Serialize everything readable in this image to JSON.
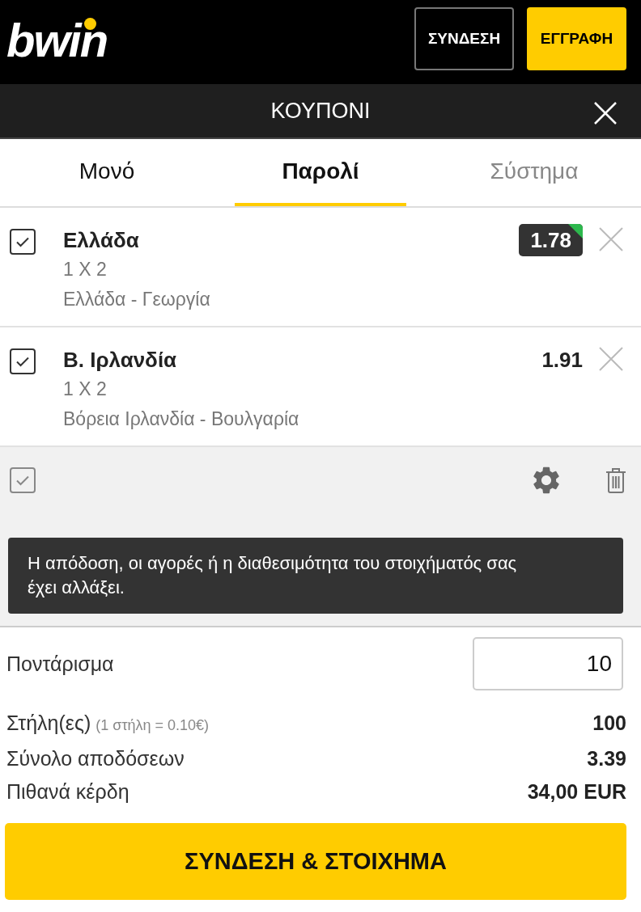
{
  "header": {
    "logo": "bwin",
    "buttons": [
      {
        "label": "ΣΥΝΔΕΣΗ",
        "kind": "outline"
      },
      {
        "label": "ΕΓΓΡΑΦΗ",
        "kind": "primary"
      }
    ]
  },
  "betslip": {
    "title": "ΚΟΥΠΟΝΙ"
  },
  "tabs": [
    {
      "label": "Μονό",
      "selected": false,
      "disabled": false
    },
    {
      "label": "Παρολί",
      "selected": true,
      "disabled": false
    },
    {
      "label": "Σύστημα",
      "selected": false,
      "disabled": true
    }
  ],
  "selections": [
    {
      "name": "Ελλάδα",
      "market": "1 X 2",
      "event": "Ελλάδα - Γεωργία",
      "odds": "1.78",
      "checked": true,
      "odds_changed": true
    },
    {
      "name": "Β. Ιρλανδία",
      "market": "1 X 2",
      "event": "Βόρεια Ιρλανδία - Βουλγαρία",
      "odds": "1.91",
      "checked": true,
      "odds_changed": false
    }
  ],
  "toolbar": {
    "select_all": {
      "checked": true
    }
  },
  "alert": {
    "message": "Η απόδοση, οι αγορές ή η διαθεσιμότητα του στοιχήματός σας έχει αλλάξει."
  },
  "stake": {
    "label": "Ποντάρισμα",
    "value": "10"
  },
  "summary": [
    {
      "label": "Στήλη(ες)",
      "note": "(1 στήλη = 0.10€)",
      "value": "100"
    },
    {
      "label": "Σύνολο αποδόσεων",
      "value": "3.39"
    },
    {
      "label": "Πιθανά κέρδη",
      "value": "34,00 EUR"
    }
  ],
  "submit": {
    "label": "ΣΥΝΔΕΣΗ & ΣΤΟΙΧΗΜΑ"
  }
}
